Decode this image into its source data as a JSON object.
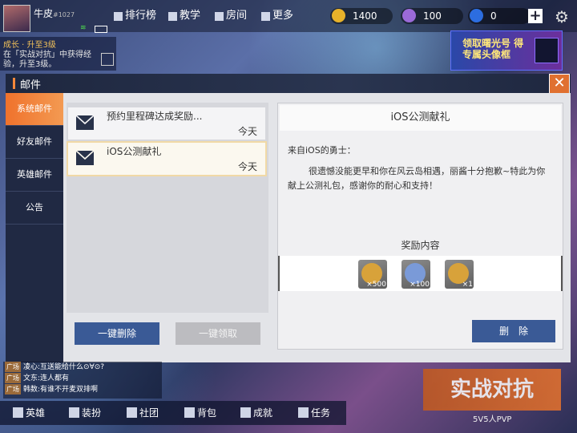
{
  "player": {
    "name": "牛皮",
    "id": "#1027"
  },
  "top_nav": [
    {
      "label": "排行榜",
      "icon": "bar-chart-icon"
    },
    {
      "label": "教学",
      "icon": "book-icon"
    },
    {
      "label": "房间",
      "icon": "home-icon"
    },
    {
      "label": "更多",
      "icon": "grid-icon"
    }
  ],
  "resources": [
    {
      "value": "1400",
      "icon": "gold-coin-icon",
      "color": "#e8b22a"
    },
    {
      "value": "100",
      "icon": "purple-gem-icon",
      "color": "#9b6ad8"
    },
    {
      "value": "0",
      "icon": "blue-gem-icon",
      "color": "#2c6de0"
    }
  ],
  "growth": {
    "title": "成长 · 升至3级",
    "desc": "在「实战对抗」中获得经验，升至3级。"
  },
  "banner": {
    "text": "领取曙光号 得 专属头像框"
  },
  "mail": {
    "title": "邮件",
    "tabs": [
      "系统邮件",
      "好友邮件",
      "英雄邮件",
      "公告"
    ],
    "active_tab": 0,
    "items": [
      {
        "title": "预约里程碑达成奖励...",
        "date": "今天"
      },
      {
        "title": "iOS公测献礼",
        "date": "今天"
      }
    ],
    "selected_item": 1,
    "buttons": {
      "delete_all": "一键删除",
      "claim_all": "一键领取",
      "delete": "删　除"
    },
    "detail": {
      "title": "iOS公测献礼",
      "greeting": "来自iOS的勇士：",
      "body": "很遗憾没能更早和你在风云岛相遇，丽酱十分抱歉~特此为你献上公测礼包，感谢你的耐心和支持！",
      "reward_heading": "奖励内容",
      "rewards": [
        {
          "quantity": "×500",
          "color": "#d8a23a"
        },
        {
          "quantity": "×100",
          "color": "#7a9ad8"
        },
        {
          "quantity": "×1",
          "color": "#d8a23a"
        }
      ]
    }
  },
  "chat": [
    {
      "channel": "广场",
      "text": "凌心:互送能给什么⊙∀⊙?"
    },
    {
      "channel": "广场",
      "text": "文东:连人都有"
    },
    {
      "channel": "广场",
      "text": "韩数:有谁不开麦双排啊"
    }
  ],
  "bottom_nav": [
    {
      "label": "英雄",
      "icon": "hero-icon"
    },
    {
      "label": "装扮",
      "icon": "wardrobe-icon"
    },
    {
      "label": "社团",
      "icon": "lock-icon"
    },
    {
      "label": "背包",
      "icon": "backpack-icon"
    },
    {
      "label": "成就",
      "icon": "lock-icon"
    },
    {
      "label": "任务",
      "icon": "task-icon"
    }
  ],
  "pvp": {
    "label": "实战对抗",
    "sub": "5V5人PVP"
  }
}
